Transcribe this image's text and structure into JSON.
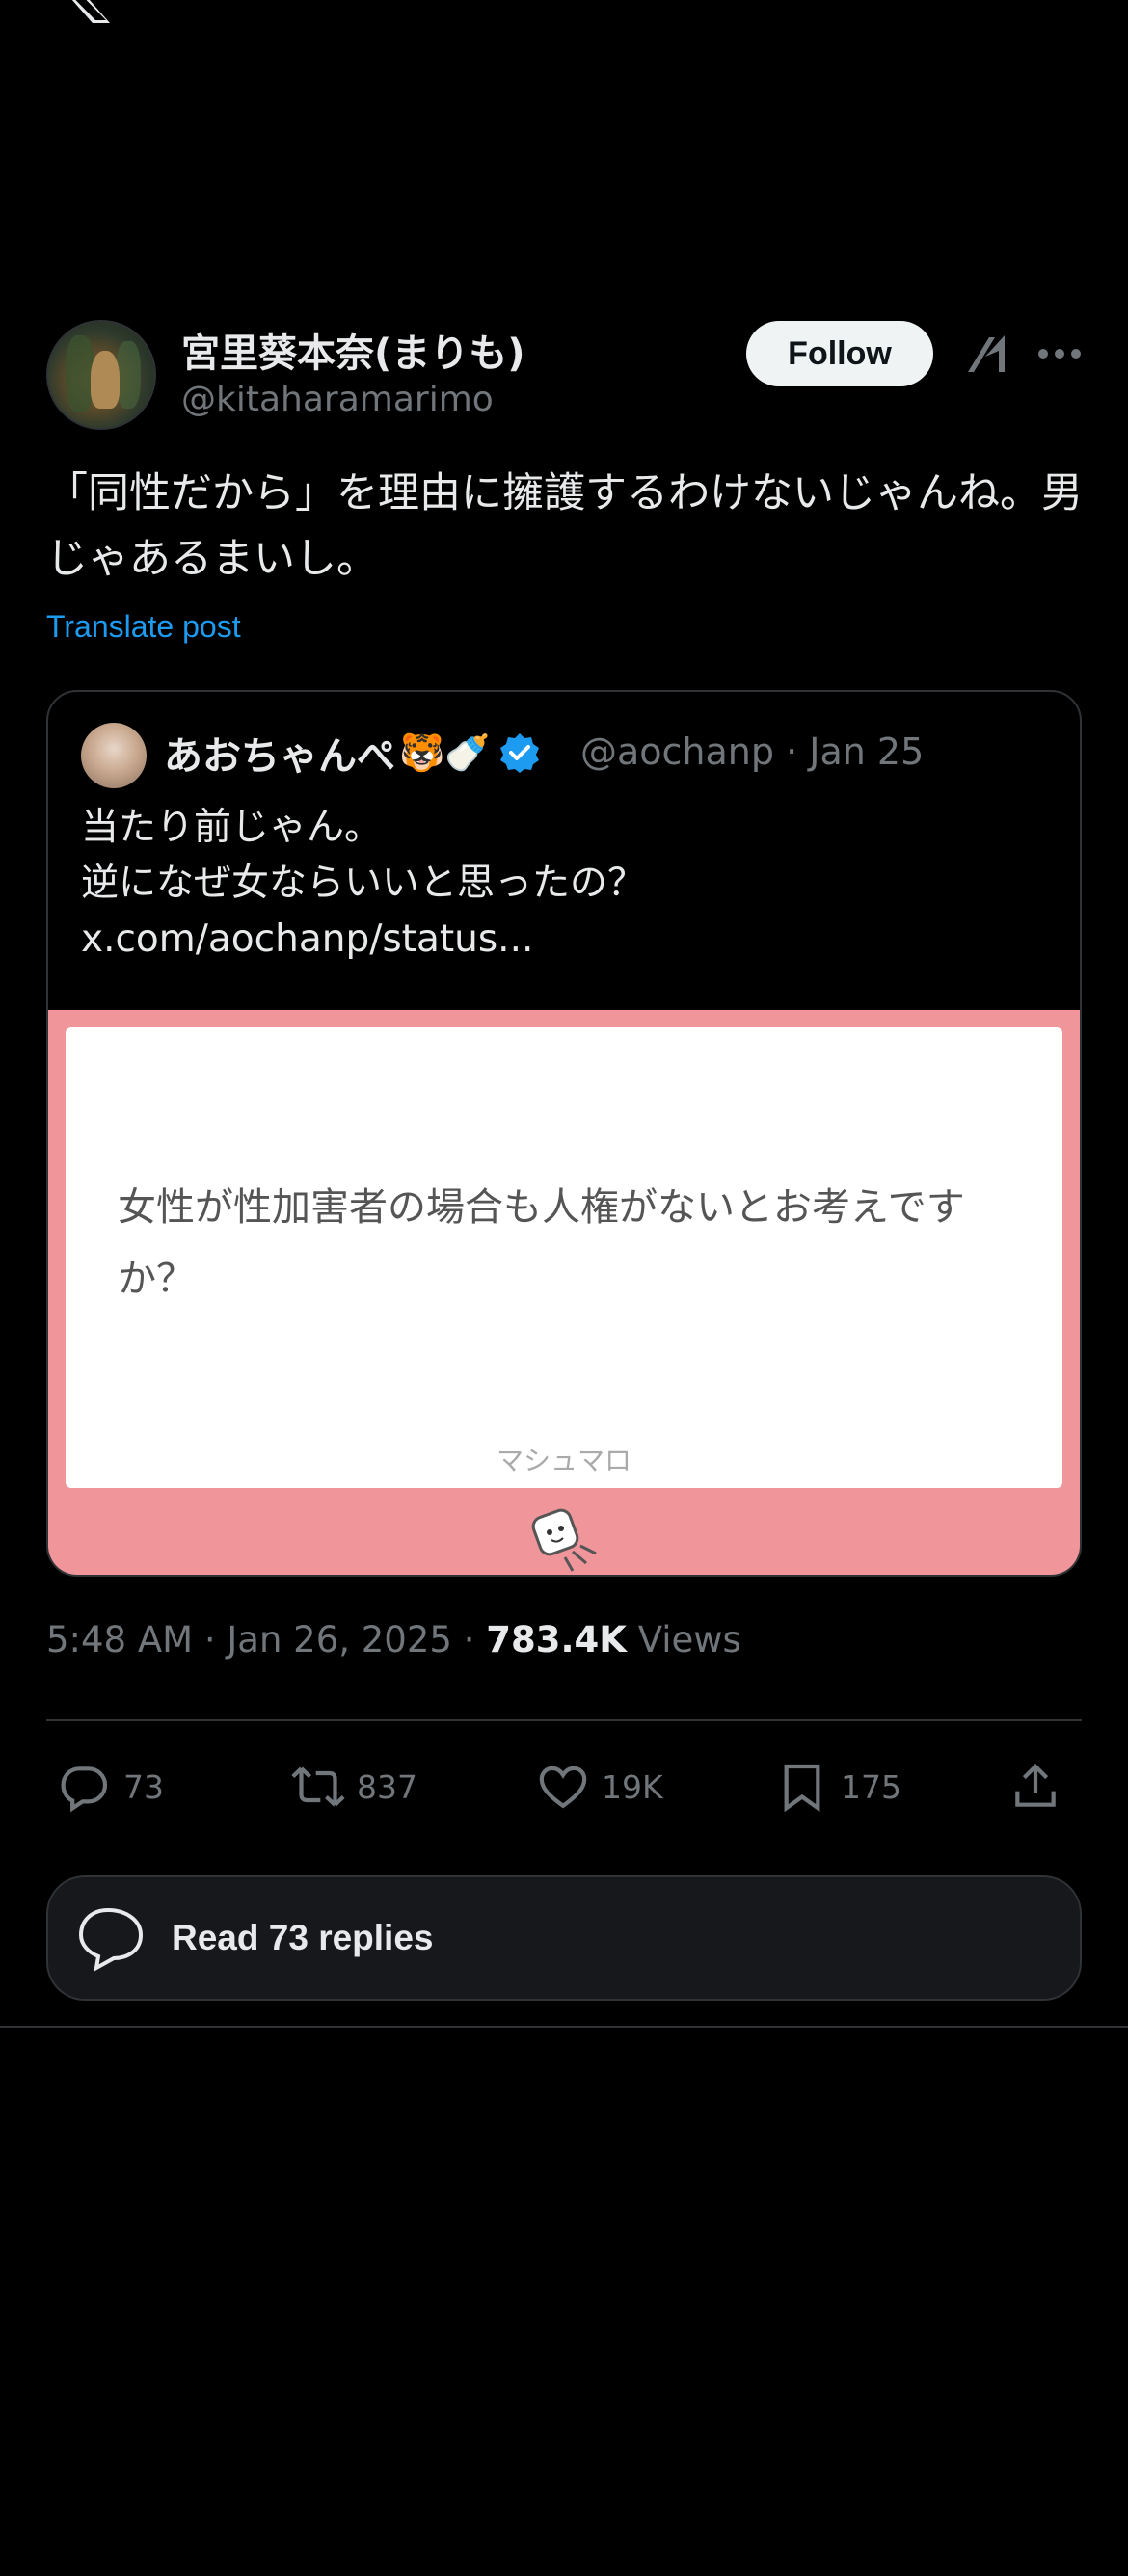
{
  "post": {
    "author": {
      "display_name": "宮里葵本奈(まりも)",
      "handle": "@kitaharamarimo"
    },
    "follow_label": "Follow",
    "text": "「同性だから」を理由に擁護するわけないじゃんね。男じゃあるまいし。",
    "translate_label": "Translate post",
    "timestamp": "5:48 AM · Jan 26, 2025 · ",
    "views_count": "783.4K",
    "views_label": " Views"
  },
  "quoted_post": {
    "display_name": "あおちゃんぺ",
    "emojis": "🐯🍼",
    "handle_date": "@aochanp · Jan 25",
    "lines": [
      "当たり前じゃん。",
      "逆になぜ女ならいいと思ったの？",
      "x.com/aochanp/status..."
    ],
    "card": {
      "question": "女性が性加害者の場合も人権がないとお考えですか？",
      "brand": "マシュマロ",
      "background_color": "#f0959a"
    },
    "verified_color": "#1d9bf0"
  },
  "actions": {
    "replies": "73",
    "reposts": "837",
    "likes": "19K",
    "bookmarks": "175"
  },
  "read_replies_label": "Read 73 replies",
  "icons": [
    "x-logo",
    "grok-icon",
    "more-icon",
    "verified-icon",
    "reply-icon",
    "repost-icon",
    "like-icon",
    "bookmark-icon",
    "share-icon",
    "conversation-icon",
    "marshmallow-icon"
  ]
}
